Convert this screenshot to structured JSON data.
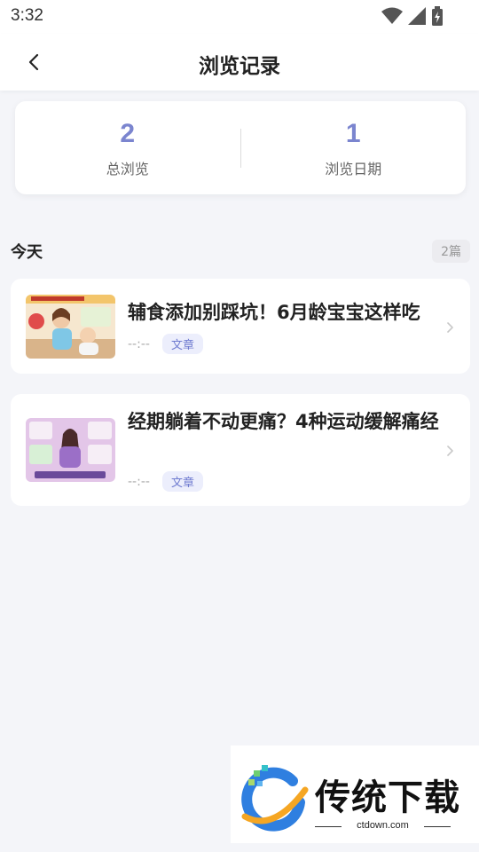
{
  "status_bar": {
    "time": "3:32"
  },
  "header": {
    "title": "浏览记录"
  },
  "stats": [
    {
      "value": "2",
      "label": "总浏览"
    },
    {
      "value": "1",
      "label": "浏览日期"
    }
  ],
  "section": {
    "title": "今天",
    "count": "2篇"
  },
  "items": [
    {
      "title": "辅食添加别踩坑！6月龄宝宝这样吃",
      "time": "--:--",
      "tag": "文章"
    },
    {
      "title": "经期躺着不动更痛？4种运动缓解痛经",
      "time": "--:--",
      "tag": "文章"
    }
  ],
  "watermark": {
    "brand": "传统下载",
    "url": "ctdown.com"
  },
  "colors": {
    "accent": "#7b85cf",
    "tag_bg": "#eceefc",
    "background": "#f4f5f9"
  }
}
